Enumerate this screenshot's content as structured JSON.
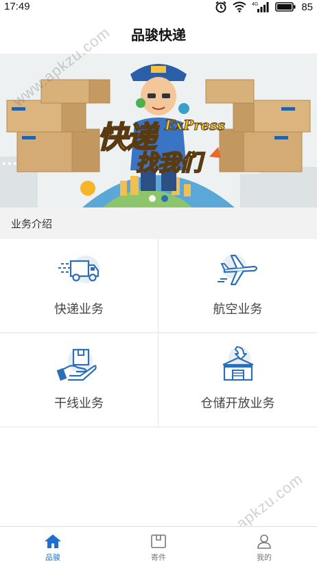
{
  "status_bar": {
    "time": "17:49",
    "battery": "85",
    "network": "4G"
  },
  "header": {
    "title": "品骏快递"
  },
  "banner": {
    "headline_big": "快递",
    "headline_script": "ExPress",
    "headline_sub": "找我们",
    "carousel": {
      "count": 2,
      "active": 0
    }
  },
  "section": {
    "title": "业务介绍"
  },
  "services": [
    {
      "label": "快递业务",
      "icon": "delivery-truck-icon"
    },
    {
      "label": "航空业务",
      "icon": "airplane-icon"
    },
    {
      "label": "干线业务",
      "icon": "hand-package-icon"
    },
    {
      "label": "仓储开放业务",
      "icon": "warehouse-icon"
    }
  ],
  "watermark": {
    "text": "www.apkzu.com"
  },
  "tabbar": {
    "items": [
      {
        "label": "品骏",
        "icon": "home-icon",
        "active": true
      },
      {
        "label": "寄件",
        "icon": "box-icon",
        "active": false
      },
      {
        "label": "我的",
        "icon": "user-icon",
        "active": false
      }
    ]
  },
  "colors": {
    "accent": "#1f6fd1",
    "icon_blue": "#2a6fb8",
    "divider": "#e4e4e4",
    "section_bg": "#f2f2f2"
  }
}
